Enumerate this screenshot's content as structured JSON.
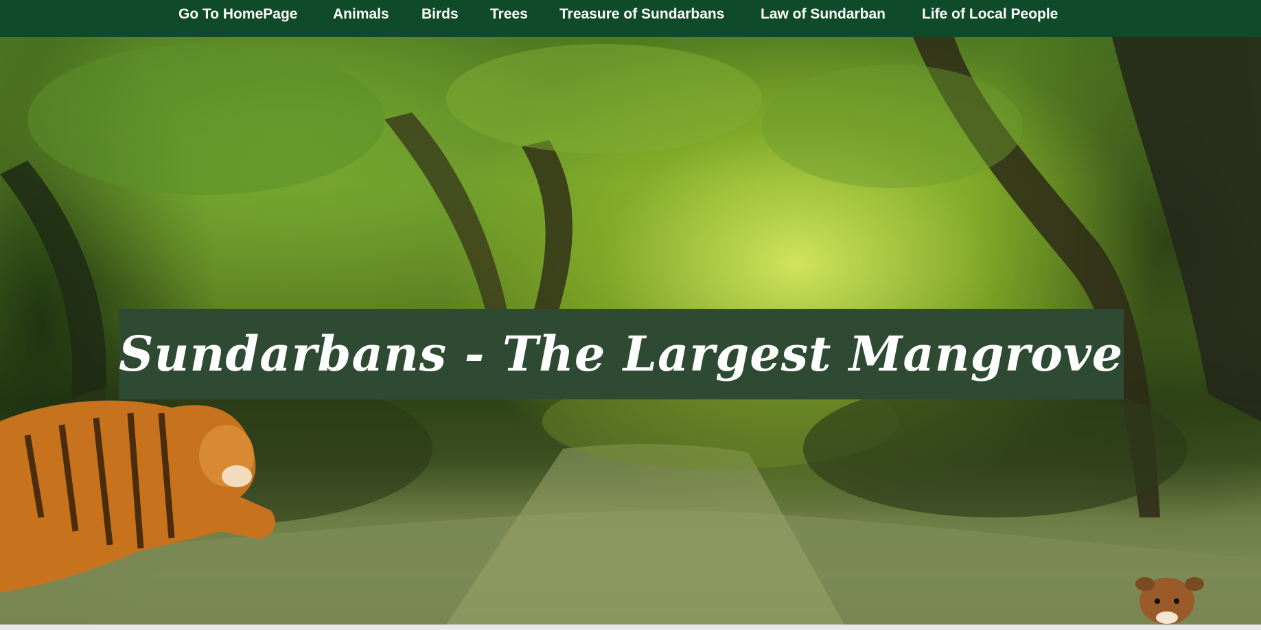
{
  "navbar": {
    "items": [
      {
        "label": "Go To HomePage"
      },
      {
        "label": "Animals"
      },
      {
        "label": "Birds"
      },
      {
        "label": "Trees"
      },
      {
        "label": "Treasure of Sundarbans"
      },
      {
        "label": "Law of Sundarban"
      },
      {
        "label": "Life of Local People"
      }
    ],
    "background_color": "#0f4a2a",
    "text_color": "#ffffff"
  },
  "hero": {
    "title": "Sundarbans - The Largest Mangrove Forest",
    "banner_color": "#2f4a32",
    "scene": [
      "mangrove-forest-canopy",
      "river-channel",
      "tiger-leaping",
      "deer-in-water"
    ]
  }
}
